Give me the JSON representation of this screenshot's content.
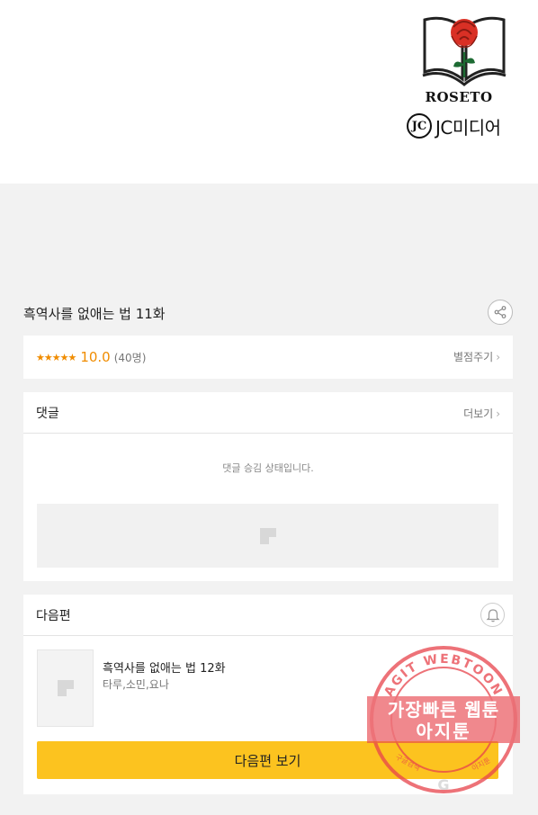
{
  "banner": {
    "publisher_word": "ROSETO",
    "jc_mark": "JC",
    "jc_name": "JC미디어",
    "icon": "rose-book-logo"
  },
  "episode": {
    "title": "흑역사를 없애는 법 11화",
    "share_icon": "share-icon"
  },
  "rating": {
    "stars": "★★★★★",
    "score": "10.0",
    "count": "(40명)",
    "rate_link": "별점주기",
    "colors": {
      "accent": "#f08c00"
    }
  },
  "comments": {
    "title": "댓글",
    "more_link": "더보기",
    "status": "댓글 승김 상태입니다."
  },
  "next": {
    "title": "다음편",
    "bell_icon": "bell-icon",
    "episode_title": "흑역사를 없애는 법 12화",
    "authors": "타루,소민,요나",
    "button_label": "다음편 보기",
    "button_color": "#fcc31f"
  },
  "watermark": {
    "arc_text": "AGIT WEBTOON",
    "line1": "가장빠른 웹툰",
    "line2": "아지툰",
    "small_left": "구글검색",
    "small_right": "아지툰",
    "center_mark": "G",
    "color": "#e8444c"
  }
}
